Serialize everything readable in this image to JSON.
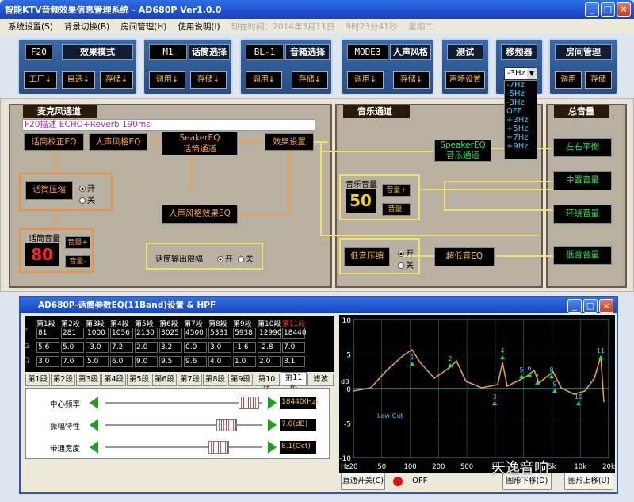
{
  "window": {
    "title": "智能KTV音频效果信息管理系统 - AD680P Ver1.0.0",
    "min": "_",
    "max": "□",
    "close": "×"
  },
  "menu": {
    "items": [
      "系统设置(S)",
      "背景切换(B)",
      "房间管理(H)",
      "使用说明(I)"
    ],
    "status_time": "现在时间：2014年3月11日",
    "status_clock": "9时23分41秒",
    "status_week": "星期二"
  },
  "toolbar": {
    "effect": {
      "lcd": "F20",
      "title": "效果模式",
      "btn1": "工厂↓",
      "btn2": "自选↓",
      "btn3": "存储↓"
    },
    "mic": {
      "lcd": "M1",
      "title": "话筒选择",
      "btn1": "调用↓",
      "btn2": "存储↓"
    },
    "speaker": {
      "lcd": "BL-1",
      "title": "音箱选择",
      "btn1": "调用↓",
      "btn2": "存储↓"
    },
    "voice": {
      "lcd": "MODE3",
      "title": "人声风格",
      "btn1": "调用↓",
      "btn2": "存储↓"
    },
    "test": {
      "title": "测试",
      "btn1": "声场设置"
    },
    "shift": {
      "title": "移频器",
      "selected": "-3Hz",
      "options": [
        "-7Hz",
        "-5Hz",
        "-3Hz",
        "OFF",
        "+3Hz",
        "+5Hz",
        "+7Hz",
        "+9Hz"
      ]
    },
    "room": {
      "title": "房间管理",
      "btn1": "调用",
      "btn2": "存储"
    }
  },
  "mic_channel": {
    "title": "麦克风通道",
    "desc": "F20描述  ECHO+Reverb 190ms",
    "eq": "话筒校正EQ",
    "style": "人声风格EQ",
    "seaker": "SeakerEQ",
    "seaker2": "话筒通道",
    "effect": "效果设置",
    "compress": "话筒压缩",
    "on": "开",
    "off": "关",
    "style_fx": "人声风格效果EQ",
    "vol_label": "话筒音量",
    "vol": "80",
    "vol_up": "音量+",
    "vol_down": "音量-",
    "limit": "话筒输出限幅",
    "limit_on": "开",
    "limit_off": "关"
  },
  "music_channel": {
    "title": "音乐通道",
    "speaker": "SpeakerEQ",
    "speaker2": "音乐通道",
    "vol_label": "音乐音量",
    "vol": "50",
    "vol_up": "音量+",
    "vol_down": "音量-",
    "bass_comp": "低音压缩",
    "on": "开",
    "off": "关",
    "sub_eq": "超低音EQ"
  },
  "master": {
    "title": "总音量",
    "balance": "左右平衡",
    "center": "中置音量",
    "surround": "环绕音量",
    "bass": "低音音量"
  },
  "eq_window": {
    "title": "AD680P-话筒参数EQ(11Band)设置 & HPF",
    "bands": [
      "第1段",
      "第2段",
      "第3段",
      "第4段",
      "第5段",
      "第6段",
      "第7段",
      "第8段",
      "第9段",
      "第10段",
      "第11段"
    ],
    "rows": [
      "F",
      "G",
      "Q"
    ],
    "F": [
      "81",
      "281",
      "1000",
      "1056",
      "2130",
      "3025",
      "4500",
      "5331",
      "5938",
      "12990",
      "18440"
    ],
    "G": [
      "5.6",
      "5.0",
      "-3.0",
      "7.2",
      "2.0",
      "3.2",
      "0.0",
      "3.0",
      "-1.6",
      "-2.8",
      "7.0"
    ],
    "Q": [
      "3.0",
      "7.0",
      "5.0",
      "6.0",
      "9.0",
      "9.5",
      "9.6",
      "4.0",
      "1.0",
      "2.0",
      "8.1"
    ],
    "tabs": [
      "第1段",
      "第2段",
      "第3段",
      "第4段",
      "第5段",
      "第6段",
      "第7段",
      "第8段",
      "第9段",
      "第10段",
      "第11段",
      "滤波"
    ],
    "freq_label": "中心频率",
    "freq_val": "18440(Hz)",
    "gain_label": "振幅特性",
    "gain_val": "7.0(dB)",
    "bw_label": "带通宽度",
    "bw_val": "8.1(Oct)",
    "bypass": "直通开关(C)",
    "off": "OFF",
    "down": "图形下移(D)",
    "up": "图形上移(U)",
    "watermark": "天逸音响"
  },
  "chart_data": {
    "type": "line",
    "ylabel": "dB",
    "ylim": [
      -10,
      10
    ],
    "yticks": [
      "10",
      "5",
      "0",
      "-5",
      "-10"
    ],
    "xticks": [
      "Hz",
      "20",
      "50",
      "100",
      "200",
      "500",
      "1k",
      "2k",
      "5k",
      "10k",
      "20k"
    ],
    "annotation": "Low-Cut",
    "band_marks": [
      "1",
      "2",
      "3",
      "4",
      "5",
      "6",
      "7",
      "8",
      "9",
      "10",
      "11"
    ]
  },
  "colors": {
    "accent": "#f0e070",
    "orange": "#f0a050",
    "curve": "#e0a040",
    "grid": "#3a8a8a"
  }
}
